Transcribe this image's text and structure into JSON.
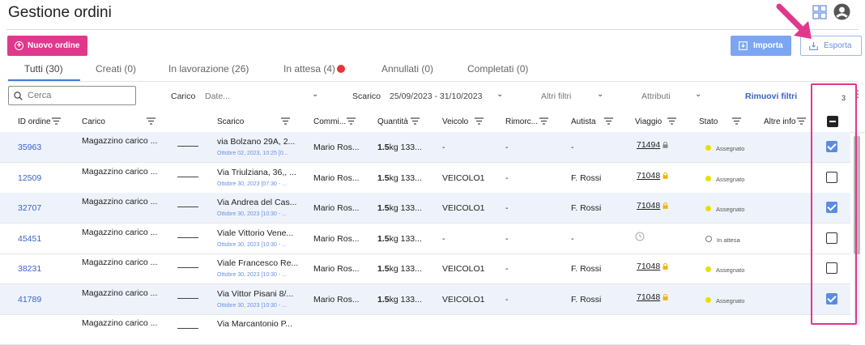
{
  "page": {
    "title": "Gestione ordini"
  },
  "toolbar": {
    "new_order": "Nuovo ordine",
    "import": "Importa",
    "export": "Esporta"
  },
  "tabs": [
    {
      "label": "Tutti (30)"
    },
    {
      "label": "Creati (0)"
    },
    {
      "label": "In lavorazione (26)"
    },
    {
      "label": "In attesa (4)"
    },
    {
      "label": "Annullati (0)"
    },
    {
      "label": "Completati (0)"
    }
  ],
  "filters": {
    "search_placeholder": "Cerca",
    "carico_label": "Carico",
    "carico_value": "Date...",
    "scarico_label": "Scarico",
    "scarico_value": "25/09/2023 - 31/10/2023",
    "altri_filtri": "Altri filtri",
    "attributi": "Attributi",
    "rimuovi": "Rimuovi filtri",
    "selected_count": "3"
  },
  "columns": {
    "id": "ID ordine",
    "carico": "Carico",
    "scarico": "Scarico",
    "committente": "Commi...",
    "quantita": "Quantità",
    "veicolo": "Veicolo",
    "rimorchio": "Rimorc...",
    "autista": "Autista",
    "viaggio": "Viaggio",
    "stato": "Stato",
    "altre_info": "Altre info"
  },
  "rows": [
    {
      "id": "35963",
      "carico": "Magazzino carico ...",
      "scarico": "via Bolzano 29A, 2...",
      "scarico_date": "Ottobre 02, 2023, 10:25 [0...",
      "committente": "Mario Ros...",
      "qty_bold": "1.5",
      "qty_rest": "kg 133...",
      "veicolo": "-",
      "rimorchio": "-",
      "autista": "-",
      "viaggio": "71494",
      "lock_color": "#888888",
      "stato": "Assegnato",
      "stato_color": "#e8e000",
      "checked": true
    },
    {
      "id": "12509",
      "carico": "Magazzino carico ...",
      "scarico": "Via Triulziana, 36,, ...",
      "scarico_date": "Ottobre 30, 2023 [07:30 - ...",
      "committente": "Mario Ros...",
      "qty_bold": "1.5",
      "qty_rest": "kg 133...",
      "veicolo": "VEICOLO1",
      "rimorchio": "-",
      "autista": "F. Rossi",
      "viaggio": "71048",
      "lock_color": "#f0b400",
      "stato": "Assegnato",
      "stato_color": "#e8e000",
      "checked": false
    },
    {
      "id": "32707",
      "carico": "Magazzino carico ...",
      "scarico": "Via Andrea del Cas...",
      "scarico_date": "Ottobre 30, 2023 [10:30 - ...",
      "committente": "Mario Ros...",
      "qty_bold": "1.5",
      "qty_rest": "kg 133...",
      "veicolo": "VEICOLO1",
      "rimorchio": "-",
      "autista": "F. Rossi",
      "viaggio": "71048",
      "lock_color": "#f0b400",
      "stato": "Assegnato",
      "stato_color": "#e8e000",
      "checked": true
    },
    {
      "id": "45451",
      "carico": "Magazzino carico ...",
      "scarico": "Viale Vittorio Vene...",
      "scarico_date": "Ottobre 30, 2023 [10:30 - ...",
      "committente": "Mario Ros...",
      "qty_bold": "1.5",
      "qty_rest": "kg 133...",
      "veicolo": "-",
      "rimorchio": "-",
      "autista": "-",
      "viaggio": "",
      "lock_color": "",
      "stato": "In attesa",
      "stato_color": "",
      "checked": false
    },
    {
      "id": "38231",
      "carico": "Magazzino carico ...",
      "scarico": "Viale Francesco Re...",
      "scarico_date": "Ottobre 30, 2023 [10:30 - ...",
      "committente": "Mario Ros...",
      "qty_bold": "1.5",
      "qty_rest": "kg 133...",
      "veicolo": "VEICOLO1",
      "rimorchio": "-",
      "autista": "F. Rossi",
      "viaggio": "71048",
      "lock_color": "#f0b400",
      "stato": "Assegnato",
      "stato_color": "#e8e000",
      "checked": false
    },
    {
      "id": "41789",
      "carico": "Magazzino carico ...",
      "scarico": "Via Vittor Pisani 8/...",
      "scarico_date": "Ottobre 30, 2023 [10:30 - ...",
      "committente": "Mario Ros...",
      "qty_bold": "1.5",
      "qty_rest": "kg 133...",
      "veicolo": "VEICOLO1",
      "rimorchio": "-",
      "autista": "F. Rossi",
      "viaggio": "71048",
      "lock_color": "#f0b400",
      "stato": "Assegnato",
      "stato_color": "#e8e000",
      "checked": true
    },
    {
      "id": "",
      "carico": "Magazzino carico ...",
      "scarico": "Via Marcantonio P...",
      "scarico_date": "",
      "committente": "",
      "qty_bold": "",
      "qty_rest": "",
      "veicolo": "",
      "rimorchio": "",
      "autista": "",
      "viaggio": "",
      "lock_color": "",
      "stato": "",
      "stato_color": "",
      "checked": false
    }
  ],
  "colors": {
    "accent_pink": "#e0388c",
    "link_blue": "#3a62c8",
    "import_blue": "#7da6f2",
    "selected_row": "#eef3fb"
  }
}
